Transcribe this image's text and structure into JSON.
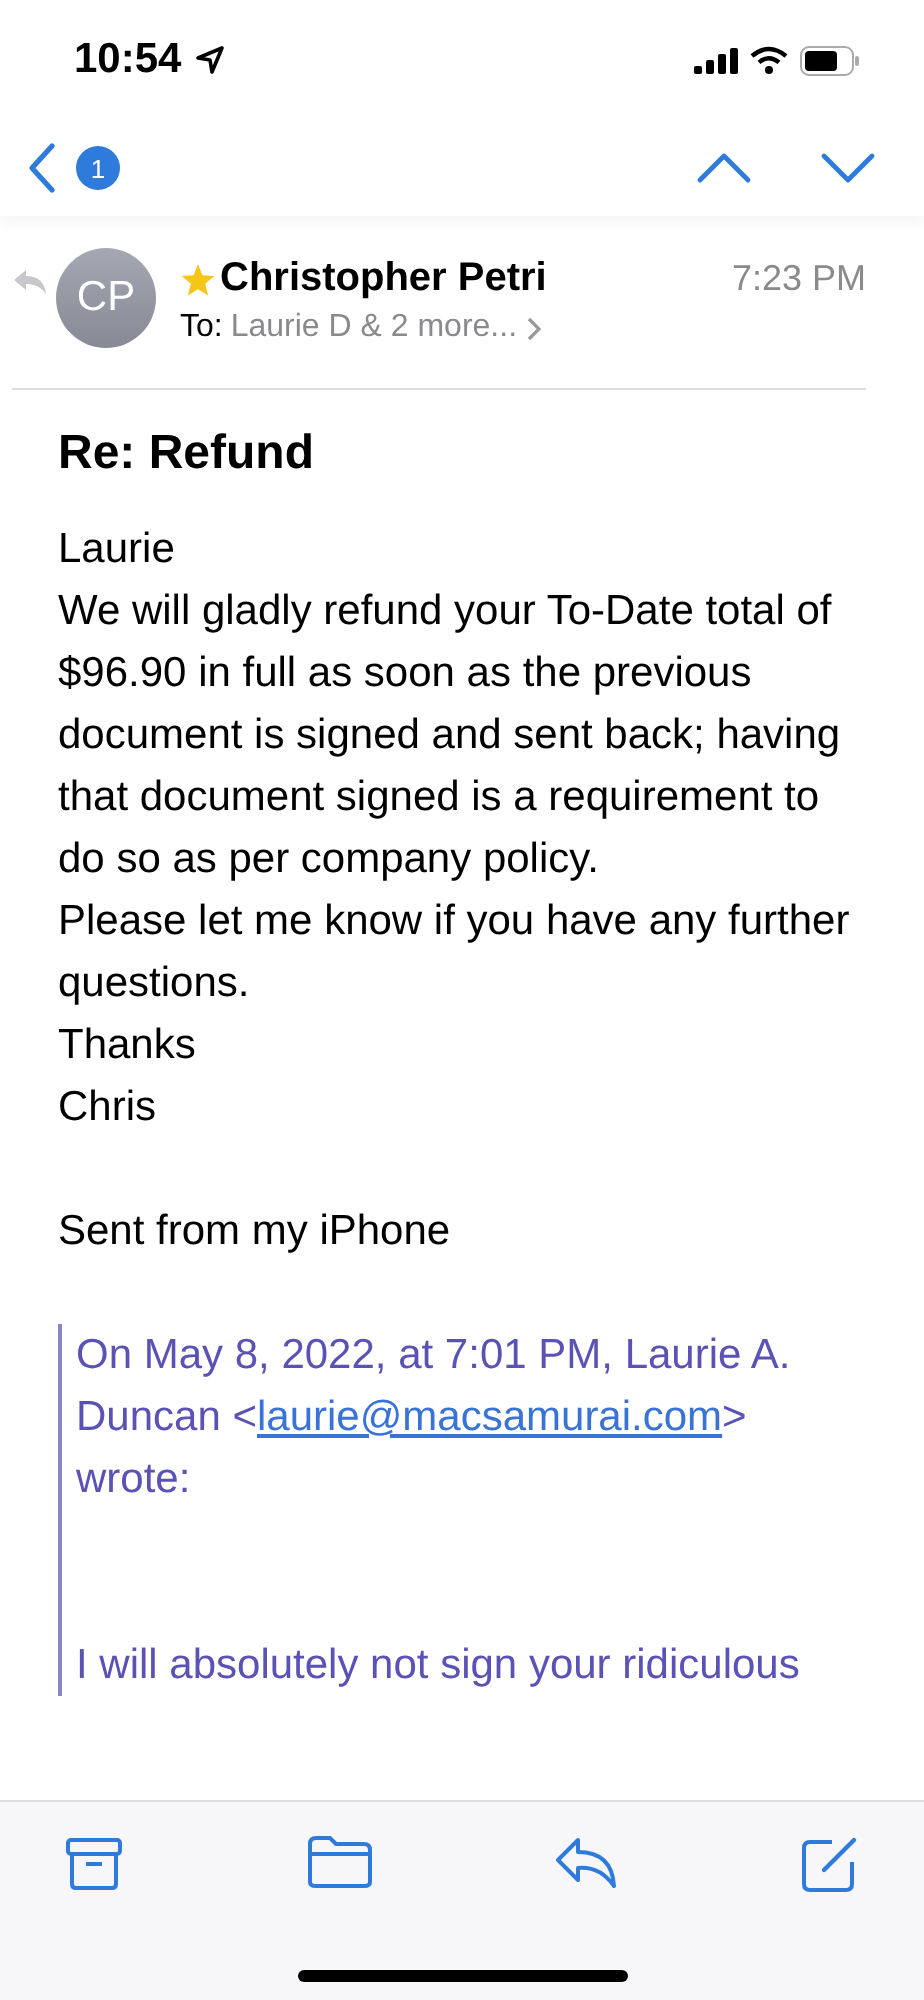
{
  "status_bar": {
    "time": "10:54"
  },
  "nav": {
    "unread_count": "1"
  },
  "message": {
    "initials": "CP",
    "sender": "Christopher Petri",
    "starred": true,
    "replied": true,
    "time": "7:23 PM",
    "to_label": "To:",
    "recipients": "Laurie D & 2 more...",
    "subject": "Re: Refund",
    "body": [
      "Laurie",
      "We will gladly refund your To-Date total of $96.90 in full as soon as the previous document is signed and sent back; having that document signed is a requirement to do so as per company policy.",
      "Please let me know if you have any further questions.",
      "Thanks",
      "Chris"
    ],
    "signature": "Sent from my iPhone",
    "quote": {
      "attribution_before": "On May 8, 2022, at 7:01 PM, Laurie A. Duncan <",
      "email": "laurie@macsamurai.com",
      "attribution_after": "> wrote:",
      "text": "I will absolutely not sign your ridiculous"
    }
  }
}
